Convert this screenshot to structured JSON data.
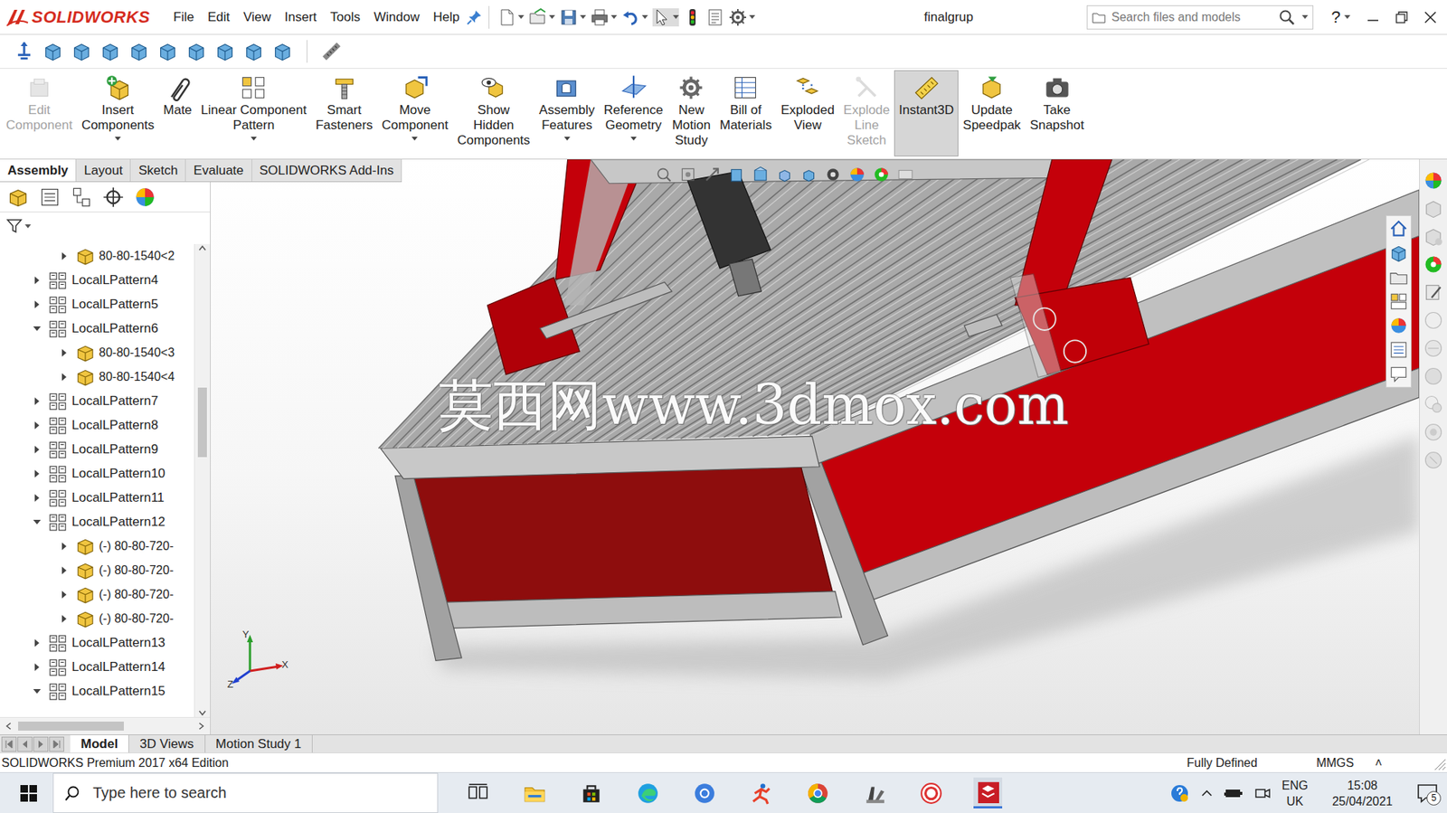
{
  "app": {
    "logo": "SOLIDWORKS"
  },
  "menu": [
    "File",
    "Edit",
    "View",
    "Insert",
    "Tools",
    "Window",
    "Help"
  ],
  "window": {
    "title": "finalgrup"
  },
  "search": {
    "placeholder": "Search files and models"
  },
  "help": "?",
  "ribbon": [
    {
      "label": [
        "Edit",
        "Component"
      ],
      "disabled": true,
      "selected": false,
      "dropdown": false
    },
    {
      "label": [
        "Insert",
        "Components"
      ],
      "disabled": false,
      "selected": false,
      "dropdown": true
    },
    {
      "label": [
        "Mate"
      ],
      "disabled": false,
      "selected": false,
      "dropdown": false
    },
    {
      "label": [
        "Linear Component",
        "Pattern"
      ],
      "disabled": false,
      "selected": false,
      "dropdown": true
    },
    {
      "label": [
        "Smart",
        "Fasteners"
      ],
      "disabled": false,
      "selected": false,
      "dropdown": false
    },
    {
      "label": [
        "Move",
        "Component"
      ],
      "disabled": false,
      "selected": false,
      "dropdown": true
    },
    {
      "label": [
        "Show",
        "Hidden",
        "Components"
      ],
      "disabled": false,
      "selected": false,
      "dropdown": false
    },
    {
      "label": [
        "Assembly",
        "Features"
      ],
      "disabled": false,
      "selected": false,
      "dropdown": true
    },
    {
      "label": [
        "Reference",
        "Geometry"
      ],
      "disabled": false,
      "selected": false,
      "dropdown": true
    },
    {
      "label": [
        "New",
        "Motion",
        "Study"
      ],
      "disabled": false,
      "selected": false,
      "dropdown": false
    },
    {
      "label": [
        "Bill of",
        "Materials"
      ],
      "disabled": false,
      "selected": false,
      "dropdown": false
    },
    {
      "label": [
        "Exploded",
        "View"
      ],
      "disabled": false,
      "selected": false,
      "dropdown": false
    },
    {
      "label": [
        "Explode",
        "Line",
        "Sketch"
      ],
      "disabled": true,
      "selected": false,
      "dropdown": false
    },
    {
      "label": [
        "Instant3D"
      ],
      "disabled": false,
      "selected": true,
      "dropdown": false
    },
    {
      "label": [
        "Update",
        "Speedpak"
      ],
      "disabled": false,
      "selected": false,
      "dropdown": false
    },
    {
      "label": [
        "Take",
        "Snapshot"
      ],
      "disabled": false,
      "selected": false,
      "dropdown": false
    }
  ],
  "tabs": [
    {
      "label": "Assembly",
      "selected": true
    },
    {
      "label": "Layout",
      "selected": false
    },
    {
      "label": "Sketch",
      "selected": false
    },
    {
      "label": "Evaluate",
      "selected": false
    },
    {
      "label": "SOLIDWORKS Add-Ins",
      "selected": false
    }
  ],
  "tree": [
    {
      "label": "80-80-1540<2",
      "kind": "part",
      "level": 1,
      "expanded": false
    },
    {
      "label": "LocalLPattern4",
      "kind": "pattern",
      "level": 0,
      "expanded": false
    },
    {
      "label": "LocalLPattern5",
      "kind": "pattern",
      "level": 0,
      "expanded": false
    },
    {
      "label": "LocalLPattern6",
      "kind": "pattern",
      "level": 0,
      "expanded": true
    },
    {
      "label": "80-80-1540<3",
      "kind": "part",
      "level": 1,
      "expanded": false
    },
    {
      "label": "80-80-1540<4",
      "kind": "part",
      "level": 1,
      "expanded": false
    },
    {
      "label": "LocalLPattern7",
      "kind": "pattern",
      "level": 0,
      "expanded": false
    },
    {
      "label": "LocalLPattern8",
      "kind": "pattern",
      "level": 0,
      "expanded": false
    },
    {
      "label": "LocalLPattern9",
      "kind": "pattern",
      "level": 0,
      "expanded": false
    },
    {
      "label": "LocalLPattern10",
      "kind": "pattern",
      "level": 0,
      "expanded": false
    },
    {
      "label": "LocalLPattern11",
      "kind": "pattern",
      "level": 0,
      "expanded": false
    },
    {
      "label": "LocalLPattern12",
      "kind": "pattern",
      "level": 0,
      "expanded": true
    },
    {
      "label": "(-) 80-80-720-",
      "kind": "part",
      "level": 1,
      "expanded": false
    },
    {
      "label": "(-) 80-80-720-",
      "kind": "part",
      "level": 1,
      "expanded": false
    },
    {
      "label": "(-) 80-80-720-",
      "kind": "part",
      "level": 1,
      "expanded": false
    },
    {
      "label": "(-) 80-80-720-",
      "kind": "part",
      "level": 1,
      "expanded": false
    },
    {
      "label": "LocalLPattern13",
      "kind": "pattern",
      "level": 0,
      "expanded": false
    },
    {
      "label": "LocalLPattern14",
      "kind": "pattern",
      "level": 0,
      "expanded": false
    },
    {
      "label": "LocalLPattern15",
      "kind": "pattern",
      "level": 0,
      "expanded": true
    }
  ],
  "viewport": {
    "watermark": "莫西网www.3dmox.com",
    "axes": [
      "Y",
      "X",
      "Z"
    ]
  },
  "bottom_tabs": [
    {
      "label": "Model",
      "selected": true
    },
    {
      "label": "3D Views",
      "selected": false
    },
    {
      "label": "Motion Study 1",
      "selected": false
    }
  ],
  "status_bar": {
    "edition": "SOLIDWORKS Premium 2017 x64 Edition",
    "state": "Fully Defined",
    "units": "MMGS",
    "units_arrow": "˄"
  },
  "taskbar": {
    "search": "Type here to search",
    "language": "ENG",
    "region": "UK",
    "time": "15:08",
    "date": "25/04/2021",
    "notifications": "5"
  }
}
